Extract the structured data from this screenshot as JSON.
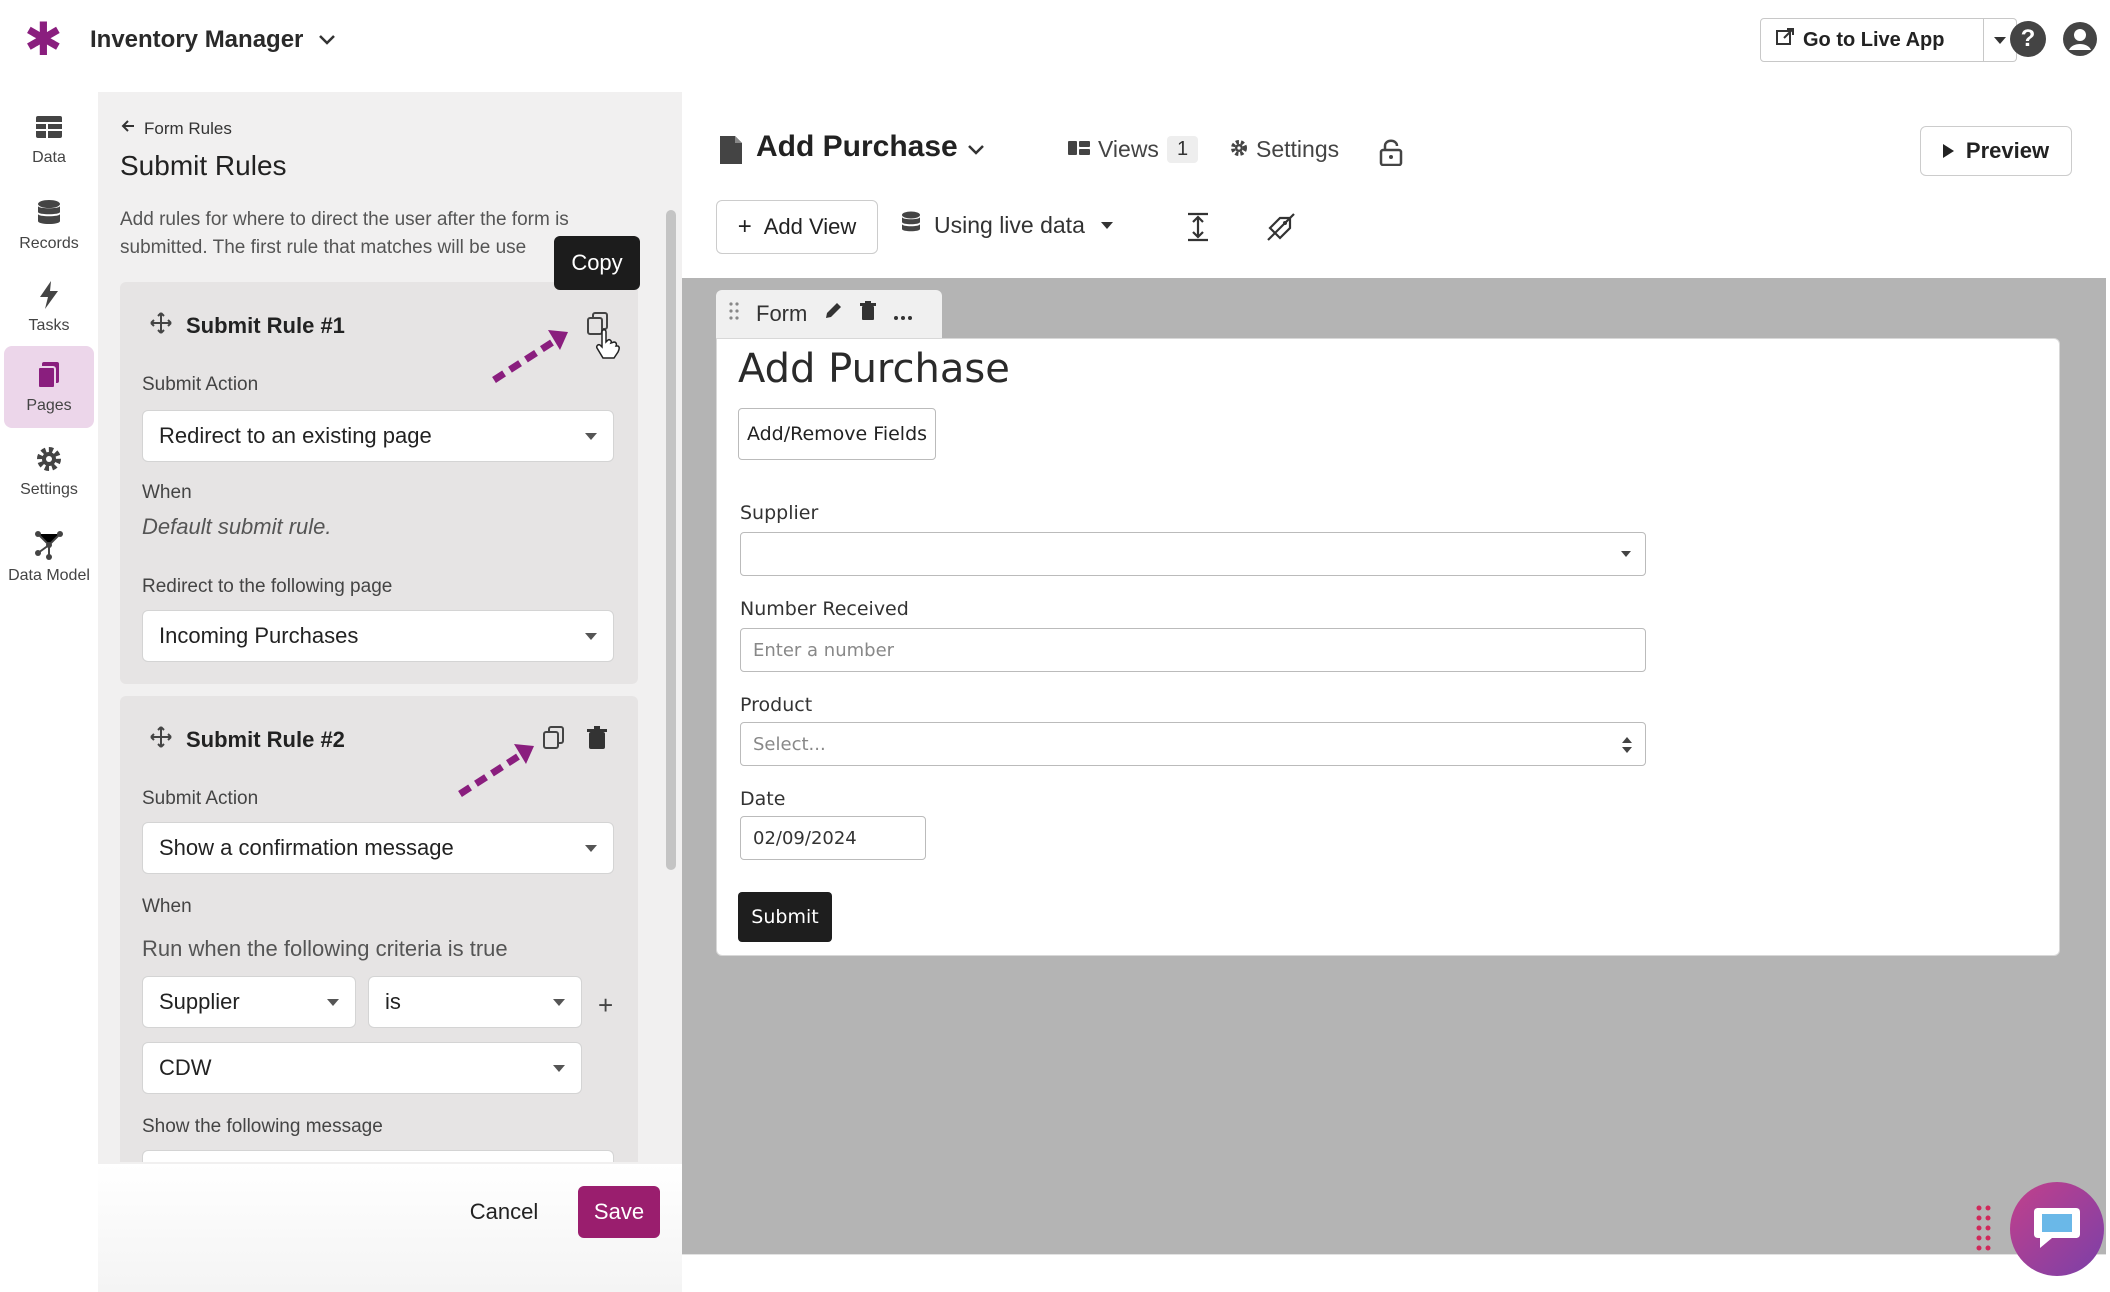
{
  "topbar": {
    "app_title": "Inventory Manager",
    "live_app_label": "Go to Live App",
    "help_icon_text": "?"
  },
  "nav": {
    "items": [
      {
        "label": "Data",
        "icon": "table-icon"
      },
      {
        "label": "Records",
        "icon": "database-icon"
      },
      {
        "label": "Tasks",
        "icon": "bolt-icon"
      },
      {
        "label": "Pages",
        "icon": "pages-icon",
        "active": true
      },
      {
        "label": "Settings",
        "icon": "gear-icon"
      },
      {
        "label": "Data Model",
        "icon": "network-icon"
      }
    ]
  },
  "rules_panel": {
    "back_label": "Form Rules",
    "title": "Submit Rules",
    "description": "Add rules for where to direct the user after the form is submitted. The first rule that matches will be use",
    "tooltip": "Copy",
    "rule1": {
      "title": "Submit Rule #1",
      "submit_action_label": "Submit Action",
      "submit_action_value": "Redirect to an existing page",
      "when_label": "When",
      "when_text": "Default submit rule.",
      "redirect_label": "Redirect to the following page",
      "redirect_value": "Incoming Purchases"
    },
    "rule2": {
      "title": "Submit Rule #2",
      "submit_action_label": "Submit Action",
      "submit_action_value": "Show a confirmation message",
      "when_label": "When",
      "criteria_text": "Run when the following criteria is true",
      "field_value": "Supplier",
      "operator_value": "is",
      "match_value": "CDW",
      "message_label": "Show the following message"
    },
    "cancel_label": "Cancel",
    "save_label": "Save"
  },
  "main": {
    "page_title": "Add Purchase",
    "views_label": "Views",
    "views_count": "1",
    "settings_label": "Settings",
    "preview_label": "Preview",
    "add_view_label": "Add View",
    "live_data_label": "Using live data",
    "form_tab_label": "Form",
    "form": {
      "title": "Add Purchase",
      "add_remove_label": "Add/Remove Fields",
      "supplier_label": "Supplier",
      "supplier_value": "",
      "number_label": "Number Received",
      "number_placeholder": "Enter a number",
      "product_label": "Product",
      "product_placeholder": "Select...",
      "date_label": "Date",
      "date_value": "02/09/2024",
      "submit_label": "Submit"
    }
  },
  "colors": {
    "brand": "#8a1e7e",
    "save_button": "#9a1e6e",
    "canvas_bg": "#b4b4b4",
    "active_nav_bg": "#ecd6ea"
  }
}
